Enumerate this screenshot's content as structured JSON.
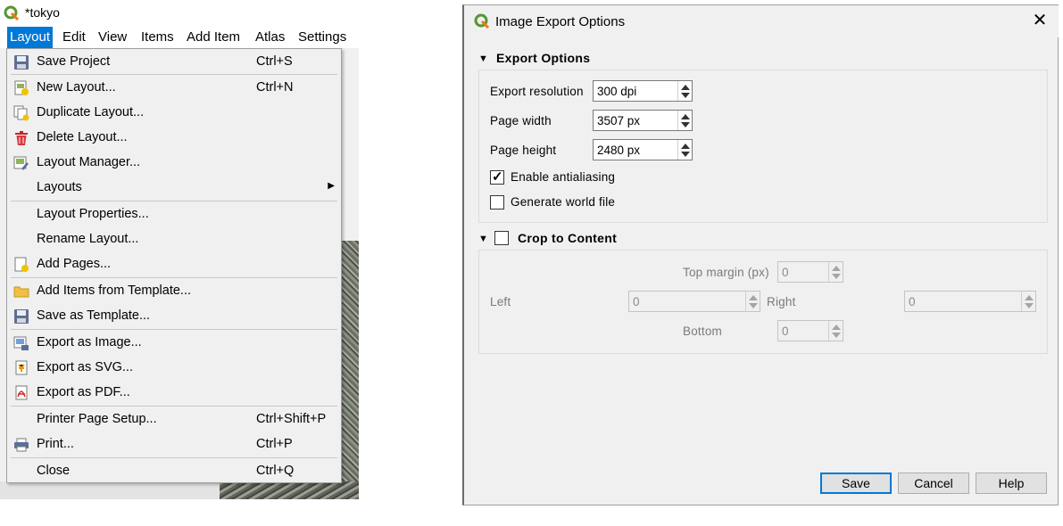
{
  "window": {
    "title": "*tokyo"
  },
  "menubar": [
    {
      "label": "Layout",
      "underline": "L",
      "rest": "ayout",
      "active": true
    },
    {
      "label": "Edit",
      "underline": "E",
      "rest": "dit"
    },
    {
      "label": "View",
      "underline": "V",
      "rest": "iew"
    },
    {
      "label": "Items",
      "underline": "I",
      "rest": "tems"
    },
    {
      "label": "Add Item",
      "underline": "A",
      "rest": "dd Item"
    },
    {
      "label": "Atlas",
      "underline": "",
      "rest": "Atlas"
    },
    {
      "label": "Settings",
      "underline": "",
      "rest": "Settings"
    }
  ],
  "layout_menu": {
    "items": [
      {
        "label": "Save Project",
        "shortcut": "Ctrl+S",
        "icon": "save-icon"
      },
      {
        "label": "New Layout...",
        "shortcut": "Ctrl+N",
        "icon": "new-layout-icon"
      },
      {
        "label": "Duplicate Layout...",
        "shortcut": "",
        "icon": "duplicate-layout-icon"
      },
      {
        "label": "Delete Layout...",
        "shortcut": "",
        "icon": "trash-icon"
      },
      {
        "label": "Layout Manager...",
        "shortcut": "",
        "icon": "layout-manager-icon"
      },
      {
        "label": "Layouts",
        "shortcut": "",
        "icon": "",
        "submenu": true
      },
      {
        "label": "Layout Properties...",
        "shortcut": "",
        "icon": ""
      },
      {
        "label": "Rename Layout...",
        "shortcut": "",
        "icon": ""
      },
      {
        "label": "Add Pages...",
        "shortcut": "",
        "icon": "add-pages-icon"
      },
      {
        "label": "Add Items from Template...",
        "shortcut": "",
        "icon": "folder-icon"
      },
      {
        "label": "Save as Template...",
        "shortcut": "",
        "icon": "save-template-icon"
      },
      {
        "label": "Export as Image...",
        "shortcut": "",
        "icon": "export-image-icon"
      },
      {
        "label": "Export as SVG...",
        "shortcut": "",
        "icon": "export-svg-icon"
      },
      {
        "label": "Export as PDF...",
        "shortcut": "",
        "icon": "export-pdf-icon"
      },
      {
        "label": "Printer Page Setup...",
        "shortcut": "Ctrl+Shift+P",
        "icon": ""
      },
      {
        "label": "Print...",
        "shortcut": "Ctrl+P",
        "icon": "printer-icon"
      },
      {
        "label": "Close",
        "shortcut": "Ctrl+Q",
        "icon": ""
      }
    ]
  },
  "dialog": {
    "title": "Image Export Options",
    "export_options": {
      "header": "Export Options",
      "resolution_label": "Export resolution",
      "resolution_value": "300 dpi",
      "width_label": "Page width",
      "width_value": "3507 px",
      "height_label": "Page height",
      "height_value": "2480 px",
      "antialias_label": "Enable antialiasing",
      "antialias_checked": true,
      "worldfile_label": "Generate world file",
      "worldfile_checked": false
    },
    "crop": {
      "header": "Crop to Content",
      "checked": false,
      "top_label": "Top margin (px)",
      "top_value": "0",
      "left_label": "Left",
      "left_value": "0",
      "right_label": "Right",
      "right_value": "0",
      "bottom_label": "Bottom",
      "bottom_value": "0"
    },
    "buttons": {
      "save": "Save",
      "cancel": "Cancel",
      "help": "Help"
    }
  },
  "colors": {
    "menu_highlight": "#0078d7",
    "default_button_border": "#0078d7"
  }
}
